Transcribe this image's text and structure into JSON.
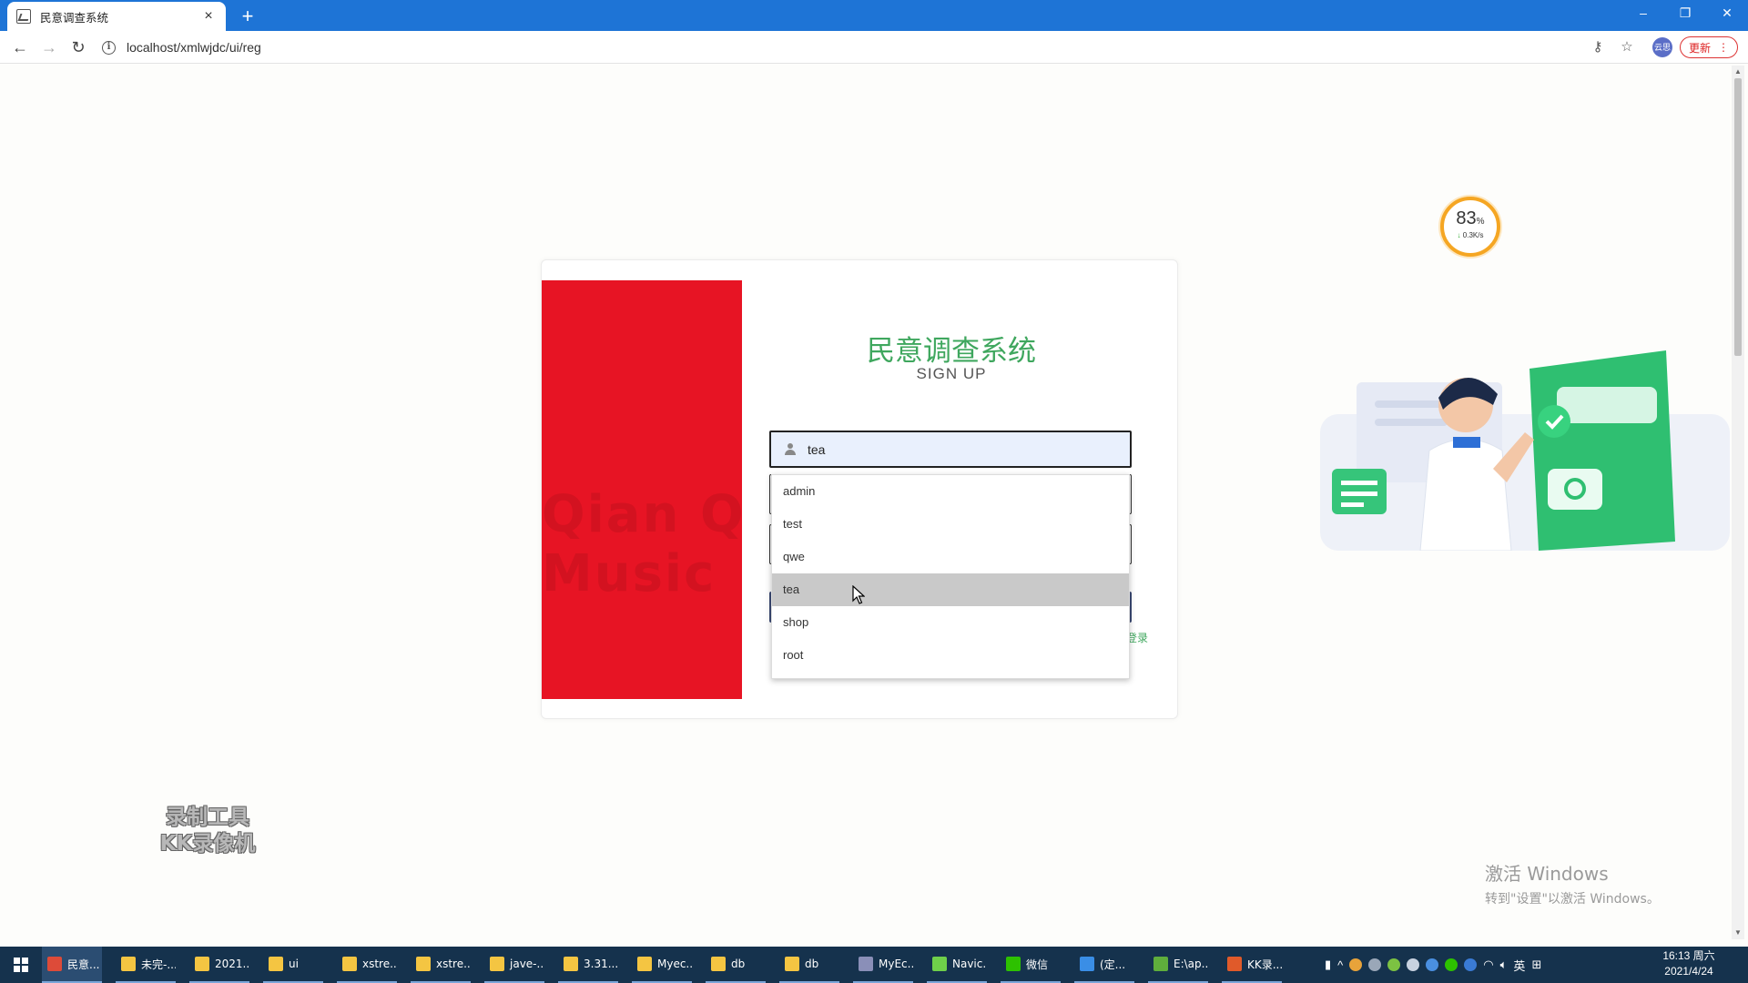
{
  "browser": {
    "tab_title": "民意调查系统",
    "tab_close": "×",
    "new_tab": "+",
    "url": "localhost/xmlwjdc/ui/reg",
    "update_label": "更新",
    "profile_label": "云思",
    "window_controls": {
      "minimize": "–",
      "restore": "❐",
      "close": "✕"
    }
  },
  "page": {
    "title": "民意调查系统",
    "subtitle": "SIGN UP",
    "username_value": "tea",
    "login_link": "登录",
    "red_panel_faint_lines": [
      "Qian Qia",
      "Music"
    ],
    "accent_color": "#3fa75e",
    "panel_color": "#e71424"
  },
  "autocomplete": {
    "items": [
      "admin",
      "test",
      "qwe",
      "tea",
      "shop",
      "root"
    ],
    "highlighted": "tea"
  },
  "net_widget": {
    "percent": "83",
    "percent_unit": "%",
    "speed": "0.3K/s"
  },
  "watermarks": {
    "kk_line1": "录制工具",
    "kk_line2": "KK录像机",
    "activate_title": "激活 Windows",
    "activate_subtitle": "转到\"设置\"以激活 Windows。"
  },
  "taskbar": {
    "items": [
      {
        "label": "民意...",
        "icon": "chrome-icon",
        "color": "#dd4b39"
      },
      {
        "label": "未完-...",
        "icon": "folder-icon",
        "color": "#f4c542"
      },
      {
        "label": "2021...",
        "icon": "folder-icon",
        "color": "#f4c542"
      },
      {
        "label": "ui",
        "icon": "folder-icon",
        "color": "#f4c542"
      },
      {
        "label": "xstre...",
        "icon": "folder-icon",
        "color": "#f4c542"
      },
      {
        "label": "xstre...",
        "icon": "folder-icon",
        "color": "#f4c542"
      },
      {
        "label": "jave-...",
        "icon": "folder-icon",
        "color": "#f4c542"
      },
      {
        "label": "3.31...",
        "icon": "folder-icon",
        "color": "#f4c542"
      },
      {
        "label": "Myec...",
        "icon": "folder-icon",
        "color": "#f4c542"
      },
      {
        "label": "db",
        "icon": "folder-icon",
        "color": "#f4c542"
      },
      {
        "label": "db",
        "icon": "folder-icon",
        "color": "#f4c542"
      },
      {
        "label": "MyEc...",
        "icon": "eclipse-icon",
        "color": "#8a8fb8"
      },
      {
        "label": "Navic...",
        "icon": "navicat-icon",
        "color": "#6fcf4a"
      },
      {
        "label": "微信",
        "icon": "wechat-icon",
        "color": "#2dc100"
      },
      {
        "label": "(定...",
        "icon": "vscode-icon",
        "color": "#3a8ee6"
      },
      {
        "label": "E:\\ap...",
        "icon": "editor-icon",
        "color": "#5fae3c"
      },
      {
        "label": "KK录...",
        "icon": "kk-recorder-icon",
        "color": "#e05a2a"
      }
    ],
    "ime_label": "英",
    "time": "16:13 周六",
    "date": "2021/4/24"
  }
}
